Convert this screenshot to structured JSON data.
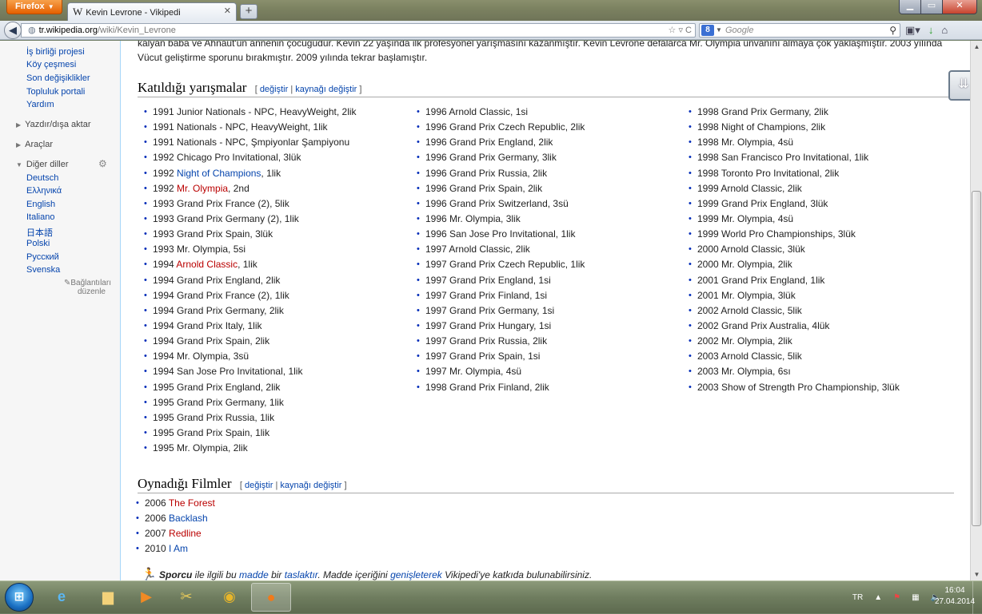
{
  "browser": {
    "menu_label": "Firefox",
    "tab_title": "Kevin Levrone - Vikipedi",
    "tab_icon": "W",
    "new_tab": "+",
    "url_host": "tr.wikipedia.org",
    "url_path": "/wiki/Kevin_Levrone",
    "search_engine_icon": "8",
    "search_placeholder": "Google"
  },
  "sidebar": {
    "nav_links": [
      "İş birliği projesi",
      "Köy çeşmesi",
      "Son değişiklikler",
      "Topluluk portali",
      "Yardım"
    ],
    "print_section": "Yazdır/dışa aktar",
    "tools_section": "Araçlar",
    "languages_section": "Diğer diller",
    "languages": [
      "Deutsch",
      "Ελληνικά",
      "English",
      "Italiano",
      "日本語",
      "Polski",
      "Русский",
      "Svenska"
    ],
    "edit_links": "Bağlantıları düzenle"
  },
  "article": {
    "top_line_1": "kalyan baba ve Ahnaut'un annenin çocuğudur. Kevin 22 yaşında ilk profesyonel yarışmasını kazanmıştır. Kevin Levrone defalarca Mr. Olympia ünvanını almaya çok yaklaşmıştır. 2003 yılında",
    "top_line_2": "Vücut geliştirme sporunu bırakmıştır. 2009 yılında tekrar başlamıştır.",
    "competitions_heading": "Katıldığı yarışmalar",
    "films_heading": "Oynadığı Filmler",
    "edit_open": "[",
    "edit_label": "değiştir",
    "edit_sep": "|",
    "edit_source_label": "kaynağı değiştir",
    "edit_close": "]",
    "competitions_col1": [
      {
        "pre": "1991 Junior Nationals - NPC, HeavyWeight, 2lik"
      },
      {
        "pre": "1991 Nationals - NPC, HeavyWeight, 1lik"
      },
      {
        "pre": "1991 Nationals - NPC, Şmpiyonlar Şampiyonu"
      },
      {
        "pre": "1992 Chicago Pro Invitational, 3lük"
      },
      {
        "pre": "1992 ",
        "link": "Night of Champions",
        "link_color": "blue",
        "post": ", 1lik"
      },
      {
        "pre": "1992 ",
        "link": "Mr. Olympia",
        "link_color": "red",
        "post": ", 2nd"
      },
      {
        "pre": "1993 Grand Prix France (2), 5lik"
      },
      {
        "pre": "1993 Grand Prix Germany (2), 1lik"
      },
      {
        "pre": "1993 Grand Prix Spain, 3lük"
      },
      {
        "pre": "1993 Mr. Olympia, 5si"
      },
      {
        "pre": "1994 ",
        "link": "Arnold Classic",
        "link_color": "red",
        "post": ", 1lik"
      },
      {
        "pre": "1994 Grand Prix England, 2lik"
      },
      {
        "pre": "1994 Grand Prix France (2), 1lik"
      },
      {
        "pre": "1994 Grand Prix Germany, 2lik"
      },
      {
        "pre": "1994 Grand Prix Italy, 1lik"
      },
      {
        "pre": "1994 Grand Prix Spain, 2lik"
      },
      {
        "pre": "1994 Mr. Olympia, 3sü"
      },
      {
        "pre": "1994 San Jose Pro Invitational, 1lik"
      },
      {
        "pre": "1995 Grand Prix England, 2lik"
      },
      {
        "pre": "1995 Grand Prix Germany, 1lik"
      },
      {
        "pre": "1995 Grand Prix Russia, 1lik"
      },
      {
        "pre": "1995 Grand Prix Spain, 1lik"
      },
      {
        "pre": "1995 Mr. Olympia, 2lik"
      }
    ],
    "competitions_col2": [
      {
        "pre": "1996 Arnold Classic, 1si"
      },
      {
        "pre": "1996 Grand Prix Czech Republic, 2lik"
      },
      {
        "pre": "1996 Grand Prix England, 2lik"
      },
      {
        "pre": "1996 Grand Prix Germany, 3lik"
      },
      {
        "pre": "1996 Grand Prix Russia, 2lik"
      },
      {
        "pre": "1996 Grand Prix Spain, 2lik"
      },
      {
        "pre": "1996 Grand Prix Switzerland, 3sü"
      },
      {
        "pre": "1996 Mr. Olympia, 3lik"
      },
      {
        "pre": "1996 San Jose Pro Invitational, 1lik"
      },
      {
        "pre": "1997 Arnold Classic, 2lik"
      },
      {
        "pre": "1997 Grand Prix Czech Republic, 1lik"
      },
      {
        "pre": "1997 Grand Prix England, 1si"
      },
      {
        "pre": "1997 Grand Prix Finland, 1si"
      },
      {
        "pre": "1997 Grand Prix Germany, 1si"
      },
      {
        "pre": "1997 Grand Prix Hungary, 1si"
      },
      {
        "pre": "1997 Grand Prix Russia, 2lik"
      },
      {
        "pre": "1997 Grand Prix Spain, 1si"
      },
      {
        "pre": "1997 Mr. Olympia, 4sü"
      },
      {
        "pre": "1998 Grand Prix Finland, 2lik"
      }
    ],
    "competitions_col3": [
      {
        "pre": "1998 Grand Prix Germany, 2lik"
      },
      {
        "pre": "1998 Night of Champions, 2lik"
      },
      {
        "pre": "1998 Mr. Olympia, 4sü"
      },
      {
        "pre": "1998 San Francisco Pro Invitational, 1lik"
      },
      {
        "pre": "1998 Toronto Pro Invitational, 2lik"
      },
      {
        "pre": "1999 Arnold Classic, 2lik"
      },
      {
        "pre": "1999 Grand Prix England, 3lük"
      },
      {
        "pre": "1999 Mr. Olympia, 4sü"
      },
      {
        "pre": "1999 World Pro Championships, 3lük"
      },
      {
        "pre": "2000 Arnold Classic, 3lük"
      },
      {
        "pre": "2000 Mr. Olympia, 2lik"
      },
      {
        "pre": "2001 Grand Prix England, 1lik"
      },
      {
        "pre": "2001 Mr. Olympia, 3lük"
      },
      {
        "pre": "2002 Arnold Classic, 5lik"
      },
      {
        "pre": "2002 Grand Prix Australia, 4lük"
      },
      {
        "pre": "2002 Mr. Olympia, 2lik"
      },
      {
        "pre": "2003 Arnold Classic, 5lik"
      },
      {
        "pre": "2003 Mr. Olympia, 6sı"
      },
      {
        "pre": "2003 Show of Strength Pro Championship, 3lük"
      }
    ],
    "films": [
      {
        "pre": "2006 ",
        "link": "The Forest",
        "link_color": "red",
        "post": ""
      },
      {
        "pre": "2006 ",
        "link": "Backlash",
        "link_color": "blue",
        "post": ""
      },
      {
        "pre": "2007 ",
        "link": "Redline",
        "link_color": "red",
        "post": ""
      },
      {
        "pre": "2010 ",
        "link": "I Am",
        "link_color": "blue",
        "post": ""
      }
    ],
    "stub": {
      "bold": "Sporcu",
      "t1": " ile ilgili bu ",
      "l1": "madde",
      "t2": " bir ",
      "l2": "taslaktır",
      "t3": ". Madde içeriğini ",
      "l3": "genişleterek",
      "t4": " Vikipedi'ye katkıda bulunabilirsiniz."
    }
  },
  "taskbar": {
    "language": "TR",
    "time": "16:04",
    "date": "27.04.2014"
  },
  "colors": {
    "link_blue": "#0645ad",
    "link_red": "#ba0000",
    "firefox_orange": "#e66000"
  }
}
